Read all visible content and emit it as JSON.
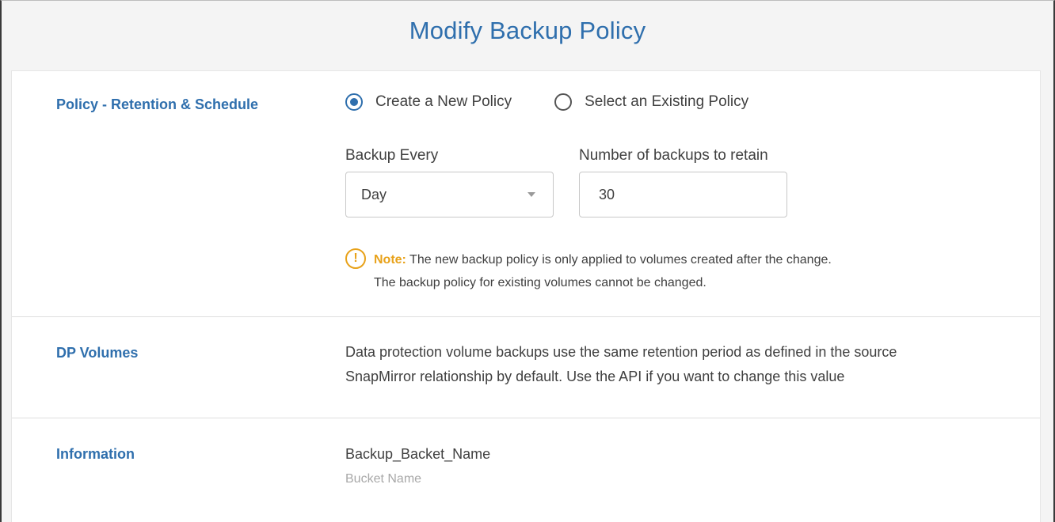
{
  "dialog": {
    "title": "Modify Backup Policy"
  },
  "policy": {
    "label": "Policy  - Retention & Schedule",
    "options": [
      {
        "label": "Create a New Policy",
        "selected": true
      },
      {
        "label": "Select an Existing Policy",
        "selected": false
      }
    ],
    "backup_every_label": "Backup Every",
    "backup_every_value": "Day",
    "retain_label": "Number of backups to retain",
    "retain_value": "30",
    "note_prefix": "Note:",
    "note_line1": " The new backup policy is only applied to volumes created after the change.",
    "note_line2": "The backup policy for existing volumes cannot be changed.",
    "note_icon_glyph": "!"
  },
  "dp_volumes": {
    "label": "DP Volumes",
    "line1": "Data protection volume backups use the same retention period as defined in the source",
    "line2": "SnapMirror relationship by default. Use the API if you want to change this value"
  },
  "information": {
    "label": "Information",
    "value": "Backup_Backet_Name",
    "sublabel": "Bucket Name"
  },
  "colors": {
    "accent": "#2f6fad",
    "warning": "#e8a21a"
  }
}
